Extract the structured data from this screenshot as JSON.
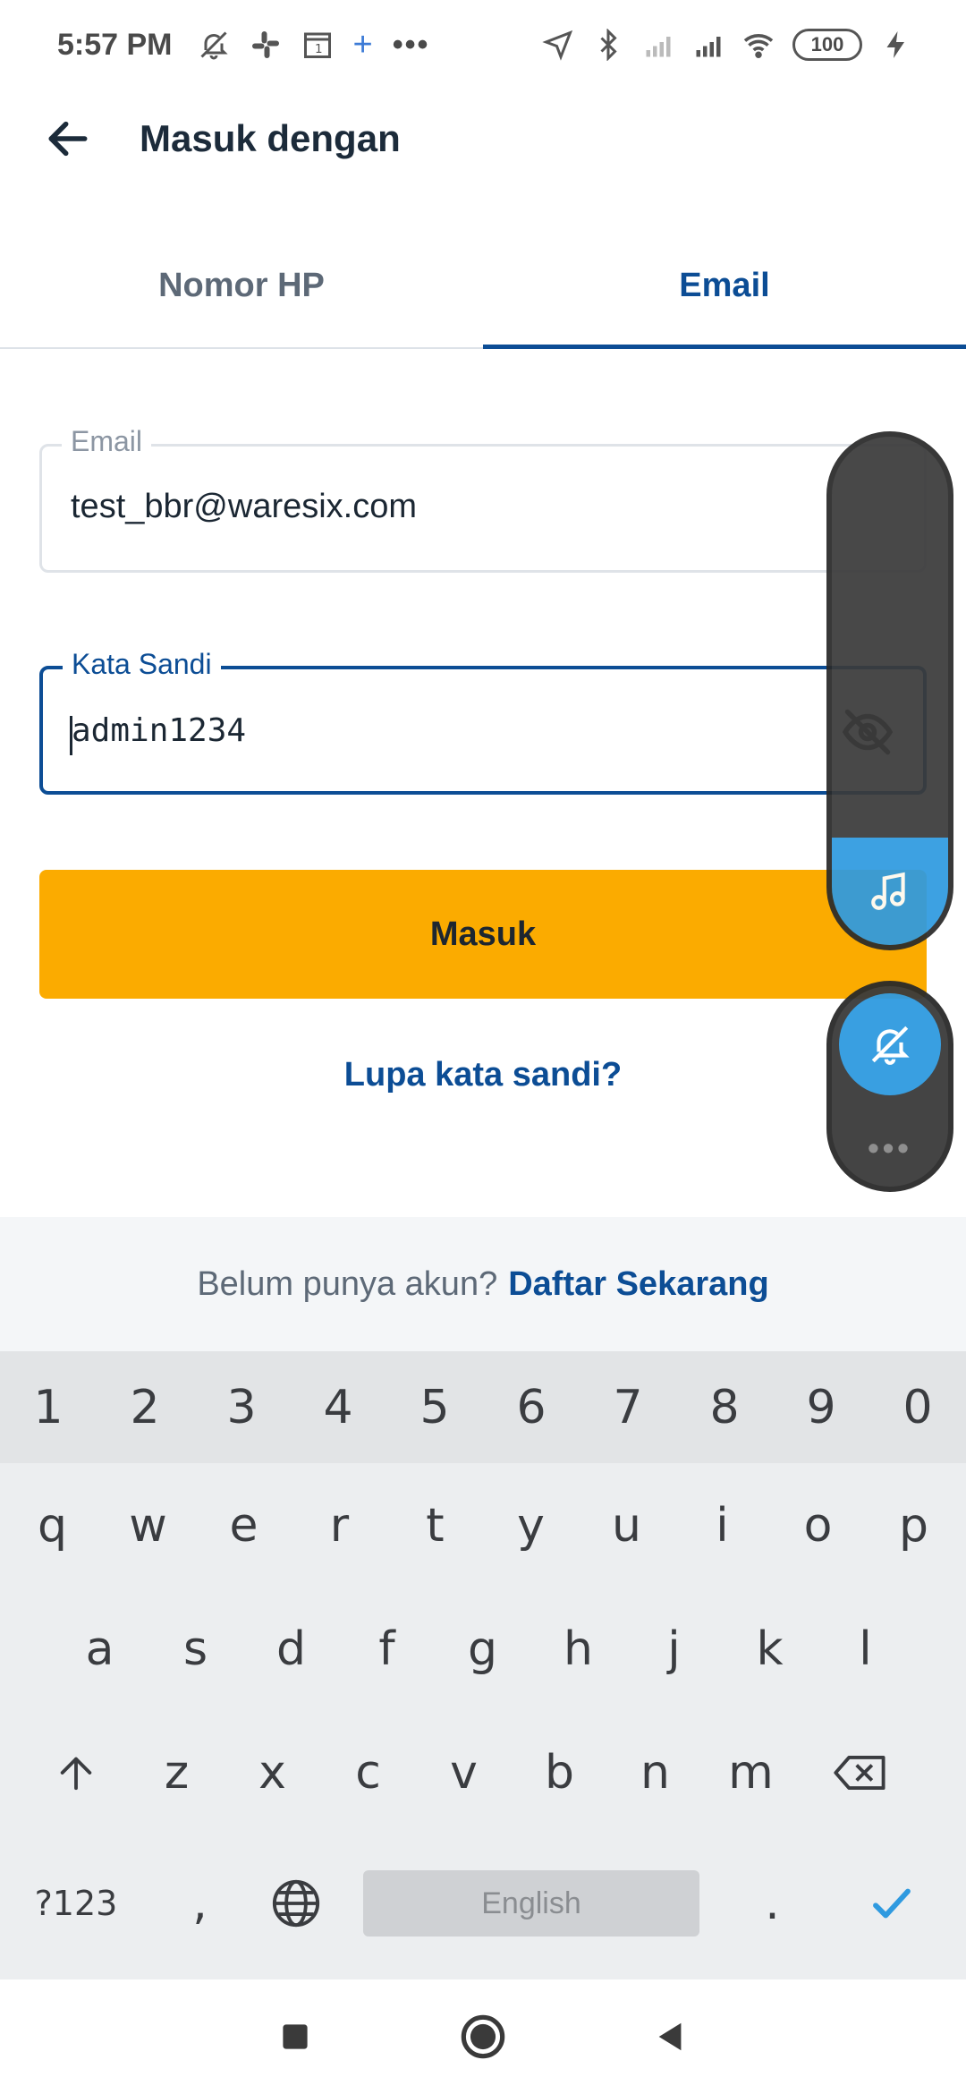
{
  "status_bar": {
    "time": "5:57 PM",
    "battery": "100",
    "plus": "+",
    "dots": "•••"
  },
  "header": {
    "title": "Masuk dengan"
  },
  "tabs": [
    {
      "label": "Nomor HP",
      "active": false
    },
    {
      "label": "Email",
      "active": true
    }
  ],
  "form": {
    "email_label": "Email",
    "email_value": "test_bbr@waresix.com",
    "password_label": "Kata Sandi",
    "password_value": "admin1234",
    "login_label": "Masuk",
    "forgot_label": "Lupa kata sandi?"
  },
  "register": {
    "prompt": "Belum punya akun?",
    "link": "Daftar Sekarang"
  },
  "keyboard": {
    "numbers": [
      "1",
      "2",
      "3",
      "4",
      "5",
      "6",
      "7",
      "8",
      "9",
      "0"
    ],
    "row1": [
      "q",
      "w",
      "e",
      "r",
      "t",
      "y",
      "u",
      "i",
      "o",
      "p"
    ],
    "row2": [
      "a",
      "s",
      "d",
      "f",
      "g",
      "h",
      "j",
      "k",
      "l"
    ],
    "row3": [
      "z",
      "x",
      "c",
      "v",
      "b",
      "n",
      "m"
    ],
    "symbols_label": "?123",
    "comma": ",",
    "space_label": "English",
    "period": "."
  },
  "colors": {
    "accent": "#0c4d95",
    "button": "#fbab00",
    "float_blue": "#2f9ae0"
  },
  "icons": [
    "back-arrow-icon",
    "eye-off-icon",
    "music-note-icon",
    "bell-off-icon",
    "shift-icon",
    "backspace-icon",
    "globe-icon",
    "check-icon",
    "nav-square-icon",
    "nav-circle-icon",
    "nav-back-icon"
  ]
}
